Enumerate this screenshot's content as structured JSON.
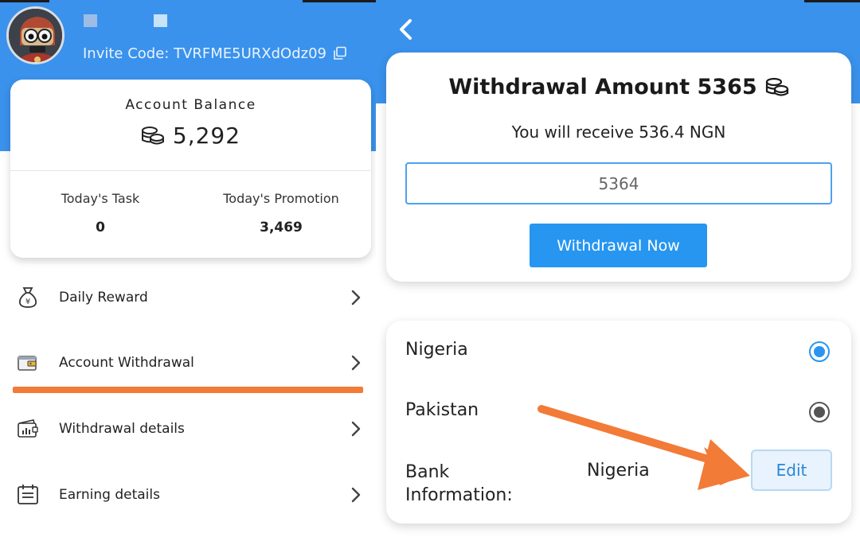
{
  "left": {
    "invite_code_label": "Invite Code: TVRFME5URXdOdz09",
    "balance": {
      "title": "Account Balance",
      "value": "5,292",
      "coin_icon": "coins-icon"
    },
    "stats": [
      {
        "label": "Today's Task",
        "value": "0"
      },
      {
        "label": "Today's Promotion",
        "value": "3,469"
      }
    ],
    "menu": [
      {
        "label": "Daily Reward",
        "icon": "money-bag-icon"
      },
      {
        "label": "Account Withdrawal",
        "icon": "wallet-icon"
      },
      {
        "label": "Withdrawal details",
        "icon": "wallet-chart-icon"
      },
      {
        "label": "Earning details",
        "icon": "calendar-list-icon"
      }
    ]
  },
  "right": {
    "amount_title": "Withdrawal Amount 5365",
    "receive_text": "You will receive 536.4 NGN",
    "amount_input_value": "5364",
    "withdraw_button_label": "Withdrawal Now",
    "countries": [
      {
        "name": "Nigeria",
        "selected": true
      },
      {
        "name": "Pakistan",
        "selected": false
      }
    ],
    "bank_label_line1": "Bank",
    "bank_label_line2": "Information:",
    "bank_value": "Nigeria",
    "edit_button_label": "Edit"
  },
  "colors": {
    "header_blue": "#3a92ec",
    "button_blue": "#2696f0",
    "annotation_orange": "#f27b37"
  }
}
